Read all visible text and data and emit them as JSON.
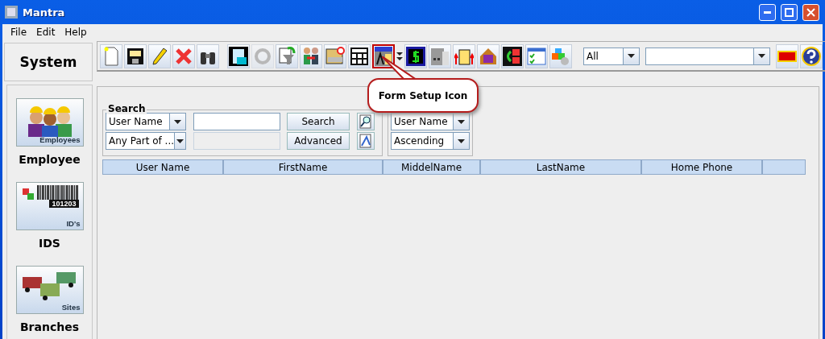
{
  "window": {
    "title": "Mantra"
  },
  "menu": [
    "File",
    "Edit",
    "Help"
  ],
  "system_label": "System",
  "toolbar": {
    "buttons": [
      {
        "highlighted": false,
        "disabled": false
      },
      {
        "highlighted": false,
        "disabled": false
      },
      {
        "highlighted": false,
        "disabled": false
      },
      {
        "highlighted": false,
        "disabled": false
      },
      {
        "highlighted": false,
        "disabled": false
      },
      {
        "highlighted": false,
        "disabled": false
      },
      {
        "highlighted": false,
        "disabled": true
      },
      {
        "highlighted": false,
        "disabled": false
      },
      {
        "highlighted": false,
        "disabled": false
      },
      {
        "highlighted": false,
        "disabled": false
      },
      {
        "highlighted": false,
        "disabled": false
      },
      {
        "highlighted": true,
        "disabled": false
      },
      {
        "highlighted": false,
        "disabled": false
      },
      {
        "highlighted": false,
        "disabled": false
      },
      {
        "highlighted": false,
        "disabled": false
      },
      {
        "highlighted": false,
        "disabled": false
      },
      {
        "highlighted": false,
        "disabled": false
      },
      {
        "highlighted": false,
        "disabled": false
      },
      {
        "highlighted": false,
        "disabled": false
      }
    ],
    "filter_combo": "All"
  },
  "callout": "Form Setup Icon",
  "sidebar": [
    {
      "badge": "Employees",
      "label": "Employee"
    },
    {
      "badge": "ID's",
      "code": "101203",
      "label": "IDS"
    },
    {
      "badge": "Sites",
      "label": "Branches"
    }
  ],
  "search": {
    "title": "Search",
    "field_combo": "User Name",
    "match_combo": "Any Part of ...",
    "search_button": "Search",
    "advanced_button": "Advanced"
  },
  "sort": {
    "field_combo": "User Name",
    "order_combo": "Ascending"
  },
  "table": {
    "columns": [
      "User Name",
      "FirstName",
      "MiddelName",
      "LastName",
      "Home Phone"
    ]
  }
}
